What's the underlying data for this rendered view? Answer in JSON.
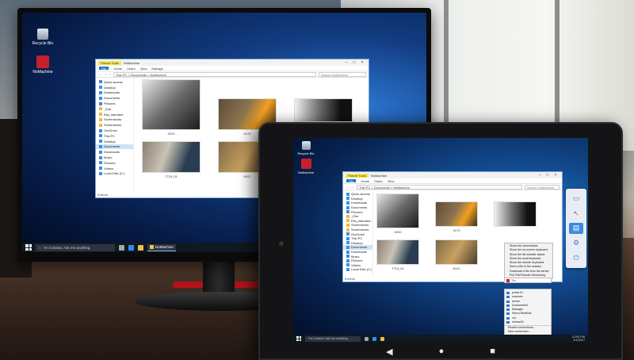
{
  "colors": {
    "win_accent": "#1a73c9",
    "app_logo_red": "#c7202b",
    "selection": "#cce4f7"
  },
  "desktop": {
    "icons": [
      {
        "name": "recycle-bin-icon",
        "label": "Recycle Bin"
      },
      {
        "name": "app-icon",
        "label": "NoMachine"
      }
    ]
  },
  "explorer": {
    "context_tab": "Picture Tools",
    "title": "NoMachine",
    "ribbon_tabs": [
      "File",
      "Home",
      "Share",
      "View",
      "Manage"
    ],
    "breadcrumb": "This PC  >  Documents  >  NoMachine",
    "search_placeholder": "Search NoMachine",
    "nav_items": [
      {
        "label": "Quick access",
        "kind": "blue"
      },
      {
        "label": "Desktop",
        "kind": "blue"
      },
      {
        "label": "Downloads",
        "kind": "blue"
      },
      {
        "label": "Documents",
        "kind": "blue"
      },
      {
        "label": "Pictures",
        "kind": "blue"
      },
      {
        "label": "_Elia",
        "kind": "folder"
      },
      {
        "label": "Elia_standard",
        "kind": "folder"
      },
      {
        "label": "Screenshots",
        "kind": "folder"
      },
      {
        "label": "Screenshots",
        "kind": "folder"
      },
      {
        "label": "OneDrive",
        "kind": "blue"
      },
      {
        "label": "This PC",
        "kind": "blue"
      },
      {
        "label": "Desktop",
        "kind": "blue"
      },
      {
        "label": "Documents",
        "kind": "blue",
        "selected": true
      },
      {
        "label": "Downloads",
        "kind": "blue"
      },
      {
        "label": "Music",
        "kind": "blue"
      },
      {
        "label": "Pictures",
        "kind": "blue"
      },
      {
        "label": "Videos",
        "kind": "blue"
      },
      {
        "label": "Local Disk (C:)",
        "kind": "blue"
      }
    ],
    "status": "6 items",
    "thumbnails": [
      {
        "label": "4010",
        "tone": [
          "#ddd",
          "#222"
        ]
      },
      {
        "label": "4173",
        "tone": [
          "#6b5a3c",
          "#f2a020"
        ]
      },
      {
        "label": "",
        "tone": [
          "#eee",
          "#111"
        ]
      },
      {
        "label": "7719_01",
        "tone": [
          "#8a8070",
          "#2a3c52"
        ]
      },
      {
        "label": "8101",
        "tone": [
          "#7d6a48",
          "#c9a060"
        ]
      }
    ]
  },
  "taskbar": {
    "search_placeholder": "I'm Cortana. Ask me anything.",
    "active_task": "NoMachine",
    "clock_time": "12:00 PM",
    "clock_date": "1/1/2017"
  },
  "tablet": {
    "context_menu_items": [
      "Show the menu/status",
      "Show the on-screen keyboard",
      "Show the file transfer status",
      "Show the local keyboard",
      "Show the remote keyboard",
      "Send a file to the session",
      "Download a file from the server",
      "Pull File/Transfer Monitoring"
    ],
    "tray_items": [
      "portal-01",
      "nxserver",
      "server",
      "Documents3",
      "Manager",
      "Sierra Realtime",
      "xx1",
      "nomach2"
    ],
    "tray_footer": [
      "Recent connections...",
      "New connection..."
    ],
    "alert_label": "The",
    "android_nav": [
      "◀",
      "●",
      "■"
    ]
  }
}
